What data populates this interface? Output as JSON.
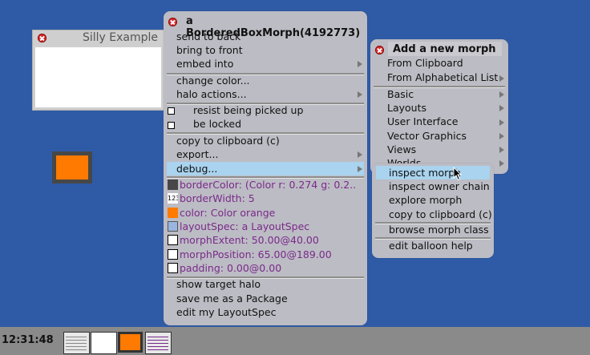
{
  "silly_window": {
    "title": "Silly Example"
  },
  "morph_menu": {
    "title": "a BorderedBoxMorph(4192773)",
    "items": [
      "send to back",
      "bring to front",
      "embed into",
      "change color...",
      "halo actions...",
      "resist being picked up",
      "be locked",
      "copy to clipboard (c)",
      "export...",
      "debug...",
      "borderColor: (Color r: 0.274 g: 0.2..",
      "borderWidth: 5",
      "color: Color orange",
      "layoutSpec: a LayoutSpec",
      "morphExtent: 50.00@40.00",
      "morphPosition: 65.00@189.00",
      "padding: 0.00@0.00",
      "show target halo",
      "save me as a Package",
      "edit my LayoutSpec"
    ],
    "icon_badge": "123"
  },
  "add_menu": {
    "title": "Add a new morph",
    "items": [
      "From Clipboard",
      "From Alphabetical List",
      "Basic",
      "Layouts",
      "User Interface",
      "Vector Graphics",
      "Views",
      "Worlds"
    ]
  },
  "debug_menu": {
    "items": [
      "inspect morph",
      "inspect owner chain",
      "explore morph",
      "copy to clipboard (c)",
      "browse morph class",
      "edit balloon help"
    ]
  },
  "taskbar": {
    "clock": "12:31:48"
  },
  "colors": {
    "desktop": "#2f5ba6",
    "menu": "#bcbcc4",
    "highlight": "#a9d3ee",
    "orange": "#ff7a00",
    "purple": "#7a2a8a"
  }
}
